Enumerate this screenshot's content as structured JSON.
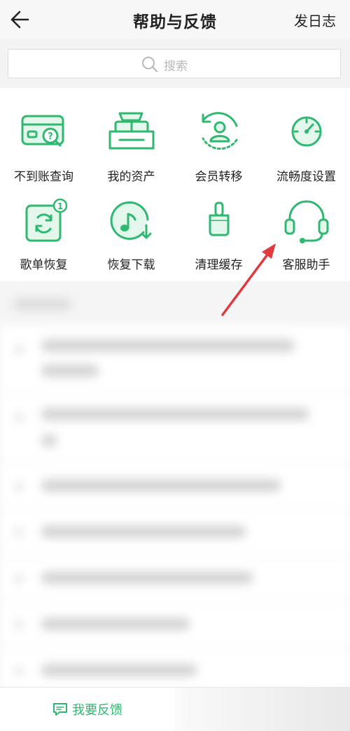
{
  "header": {
    "title": "帮助与反馈",
    "right_action": "发日志"
  },
  "search": {
    "placeholder": "搜索"
  },
  "grid": {
    "items": [
      {
        "label": "不到账查询",
        "icon": "card-search-icon"
      },
      {
        "label": "我的资产",
        "icon": "gift-box-icon"
      },
      {
        "label": "会员转移",
        "icon": "user-transfer-icon"
      },
      {
        "label": "流畅度设置",
        "icon": "gauge-icon"
      },
      {
        "label": "歌单恢复",
        "icon": "playlist-restore-icon"
      },
      {
        "label": "恢复下载",
        "icon": "music-download-icon"
      },
      {
        "label": "清理缓存",
        "icon": "brush-icon"
      },
      {
        "label": "客服助手",
        "icon": "headset-icon"
      }
    ]
  },
  "footer": {
    "feedback_label": "我要反馈"
  },
  "colors": {
    "accent": "#2fb86f",
    "annotation_arrow": "#e0393e"
  }
}
